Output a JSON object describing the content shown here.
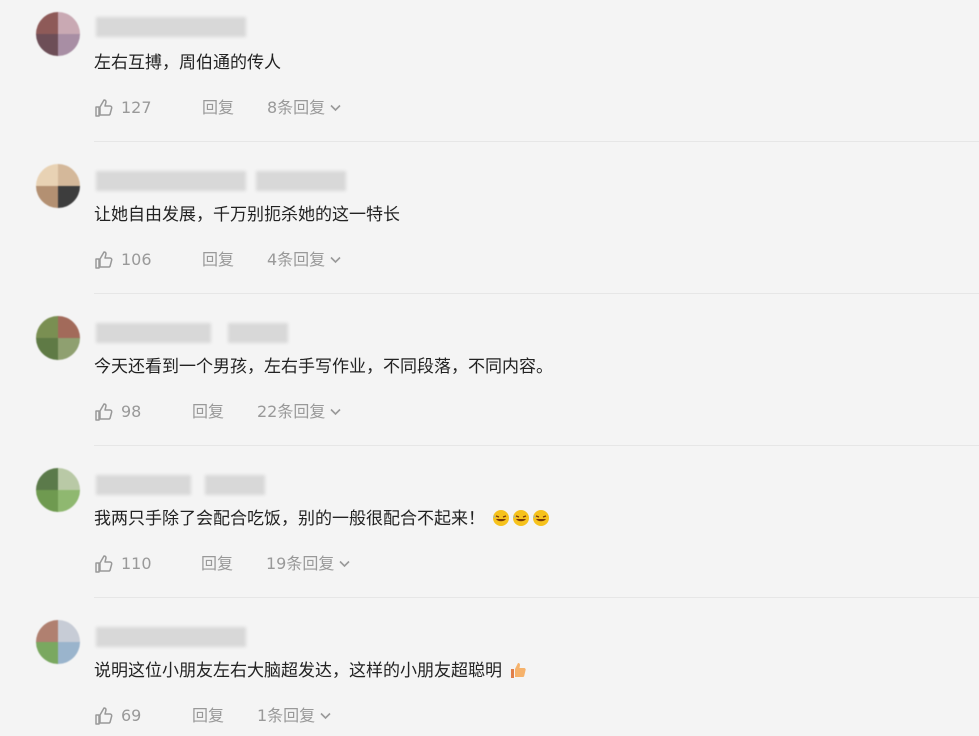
{
  "colors": {
    "background": "#f4f4f4",
    "text": "#222222",
    "meta": "#999999",
    "divider": "#e6e6e6"
  },
  "comments": [
    {
      "text": "左右互搏，周伯通的传人",
      "likes": "127",
      "reply_label": "回复",
      "replies_label": "8条回复",
      "emojis": []
    },
    {
      "text": "让她自由发展，千万别扼杀她的这一特长",
      "likes": "106",
      "reply_label": "回复",
      "replies_label": "4条回复",
      "emojis": []
    },
    {
      "text": "今天还看到一个男孩，左右手写作业，不同段落，不同内容。",
      "likes": "98",
      "reply_label": "回复",
      "replies_label": "22条回复",
      "emojis": []
    },
    {
      "text": "我两只手除了会配合吃饭，别的一般很配合不起来！",
      "likes": "110",
      "reply_label": "回复",
      "replies_label": "19条回复",
      "emojis": [
        "rofl-emoji",
        "rofl-emoji",
        "rofl-emoji"
      ]
    },
    {
      "text": "说明这位小朋友左右大脑超发达，这样的小朋友超聪明",
      "likes": "69",
      "reply_label": "回复",
      "replies_label": "1条回复",
      "emojis": [
        "thumbs-up-emoji"
      ]
    }
  ]
}
